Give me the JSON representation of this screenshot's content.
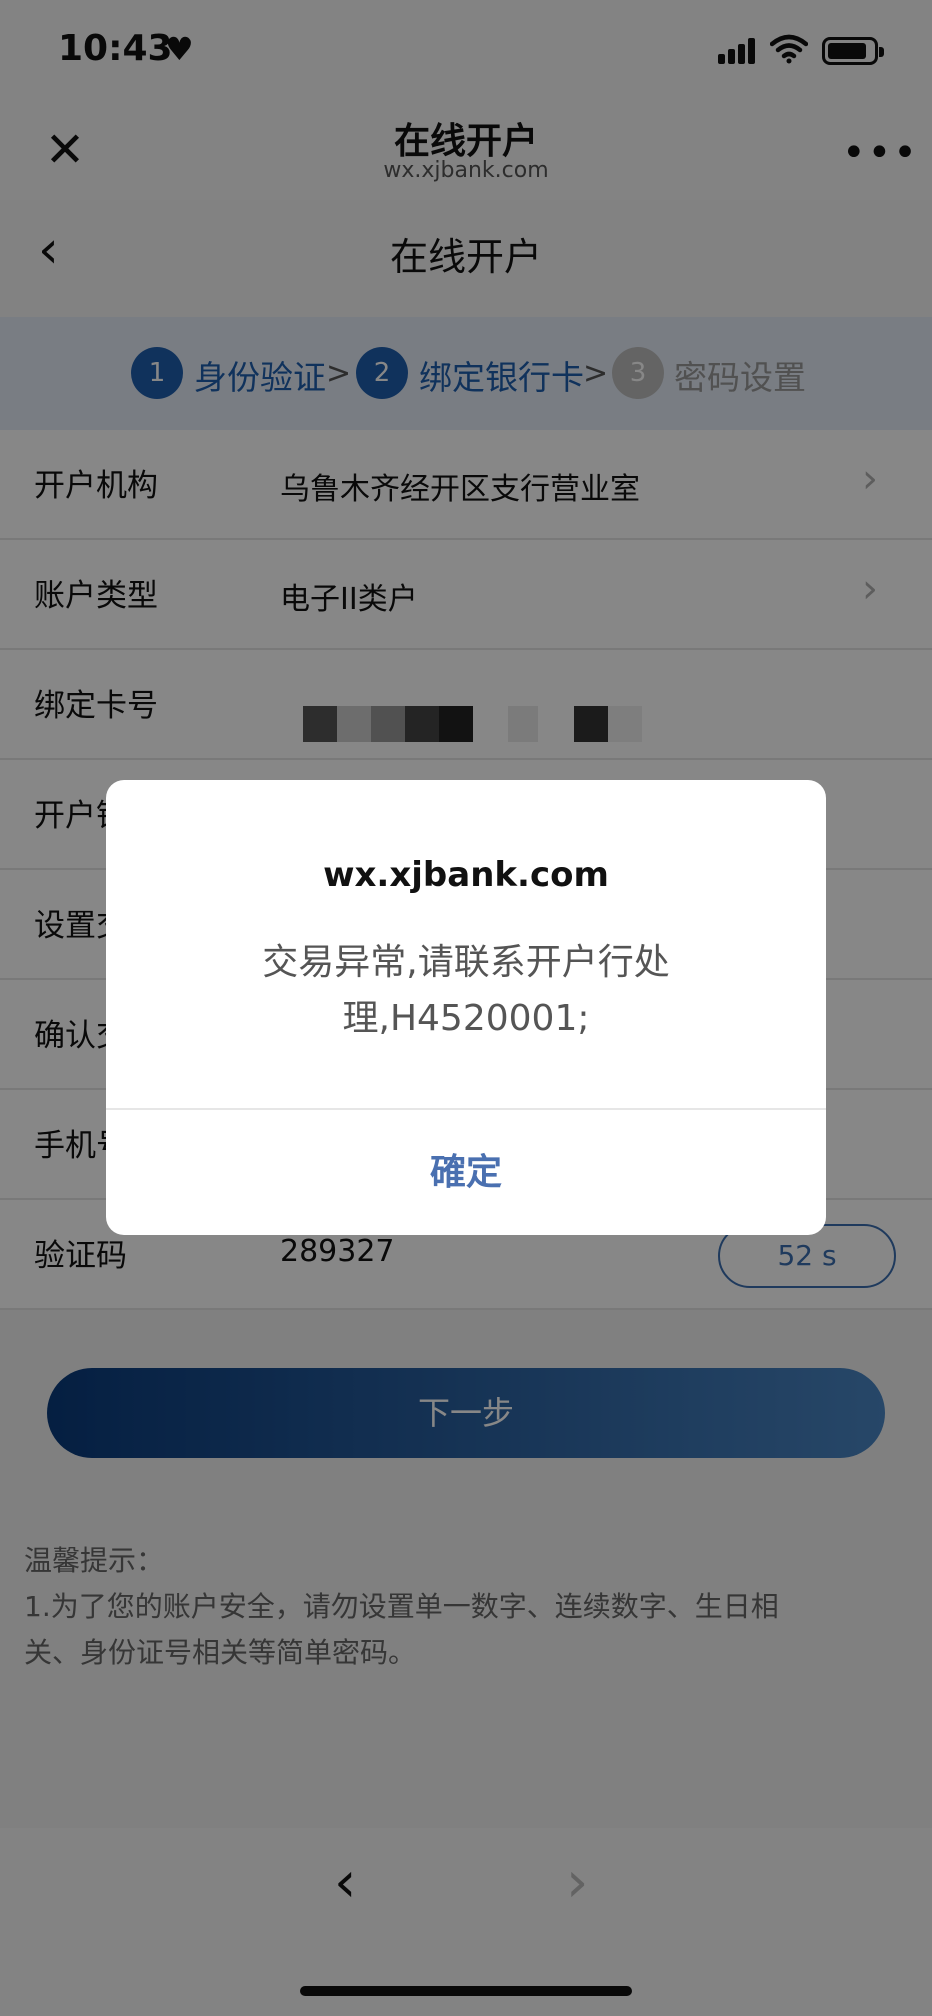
{
  "status_bar": {
    "time": "10:43"
  },
  "browser": {
    "title": "在线开户",
    "url": "wx.xjbank.com"
  },
  "page": {
    "title": "在线开户"
  },
  "steps": [
    {
      "num": "1",
      "label": "身份验证",
      "state": "done"
    },
    {
      "num": "2",
      "label": "绑定银行卡",
      "state": "active"
    },
    {
      "num": "3",
      "label": "密码设置",
      "state": "pending"
    }
  ],
  "step_separator": ">",
  "form": {
    "rows": [
      {
        "label": "开户机构",
        "value": "乌鲁木齐经开区支行营业室"
      },
      {
        "label": "账户类型",
        "value": "电子II类户"
      },
      {
        "label": "绑定卡号",
        "value": ""
      },
      {
        "label": "开户银行",
        "value": ""
      },
      {
        "label": "设置交易密码",
        "value": ""
      },
      {
        "label": "确认交易密码",
        "value": ""
      },
      {
        "label": "手机号",
        "value": ""
      },
      {
        "label": "验证码",
        "value": "289327"
      }
    ],
    "countdown": "52 s"
  },
  "next_button": "下一步",
  "tips": {
    "title": "温馨提示：",
    "line1": "1.为了您的账户安全，请勿设置单一数字、连续数字、生日相",
    "line2": "关、身份证号相关等简单密码。"
  },
  "alert": {
    "title": "wx.xjbank.com",
    "message_line1": "交易异常,请联系开户行处",
    "message_line2": "理,H4520001;",
    "confirm": "確定"
  },
  "colors": {
    "accent": "#1f5fae",
    "step_active": "#1f5fae",
    "step_pending": "#bdbdbd",
    "dialog_button": "#4a70b0"
  },
  "icons": {
    "close": "close-icon",
    "more": "more-icon",
    "back": "back-arrow-icon",
    "chevron": "chevron-right-icon"
  }
}
